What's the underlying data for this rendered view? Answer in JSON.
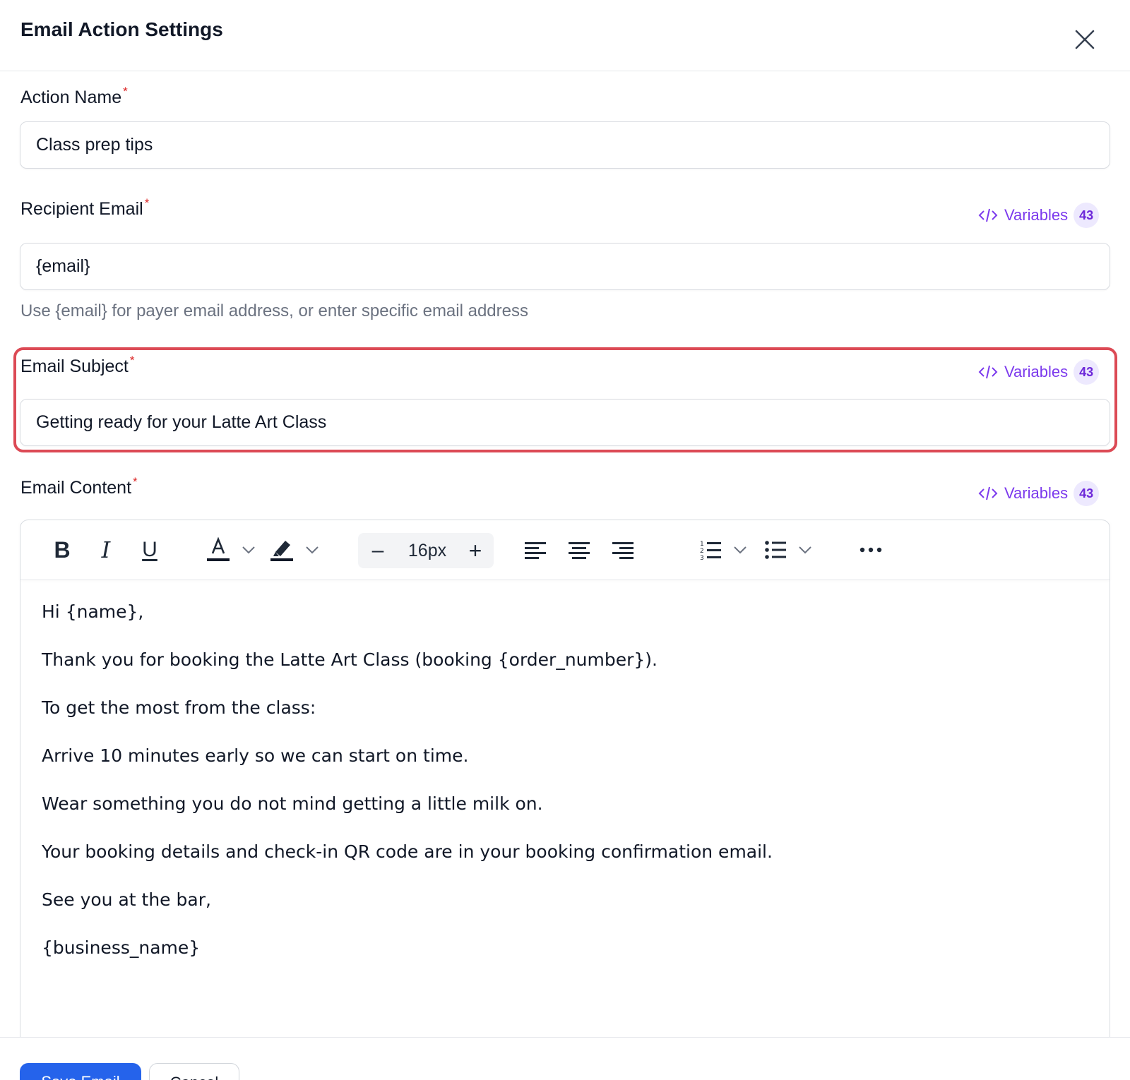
{
  "dialog": {
    "title": "Email Action Settings",
    "close_icon": "close-icon"
  },
  "fields": {
    "action_name": {
      "label": "Action Name",
      "required_mark": "*",
      "value": "Class prep tips"
    },
    "recipient_email": {
      "label": "Recipient Email",
      "required_mark": "*",
      "value": "{email}",
      "hint": "Use {email} for payer email address, or enter specific email address"
    },
    "email_subject": {
      "label": "Email Subject",
      "required_mark": "*",
      "value": "Getting ready for your Latte Art Class"
    },
    "email_content": {
      "label": "Email Content",
      "required_mark": "*"
    }
  },
  "variables": {
    "label": "Variables",
    "count": "43",
    "icon": "code-icon"
  },
  "toolbar": {
    "bold": "B",
    "italic": "I",
    "underline": "U",
    "font_size": "16px",
    "minus": "–",
    "plus": "+",
    "icons": [
      "text-color-icon",
      "highlight-icon",
      "align-left-icon",
      "align-center-icon",
      "align-right-icon",
      "numbered-list-icon",
      "bullet-list-icon",
      "more-icon"
    ]
  },
  "content": {
    "paragraphs": [
      "Hi {name},",
      "Thank you for booking the Latte Art Class (booking {order_number}).",
      "To get the most from the class:",
      "Arrive 10 minutes early so we can start on time.",
      "Wear something you do not mind getting a little milk on.",
      "Your booking details and check-in QR code are in your booking confirmation email.",
      "See you at the bar,",
      "{business_name}"
    ]
  },
  "footer": {
    "primary_label": "Save Email",
    "secondary_label": "Cancel"
  },
  "colors": {
    "accent": "#7c3aed",
    "required": "#dc2626",
    "highlight_border": "#dc4a55",
    "primary_button": "#2563eb"
  }
}
